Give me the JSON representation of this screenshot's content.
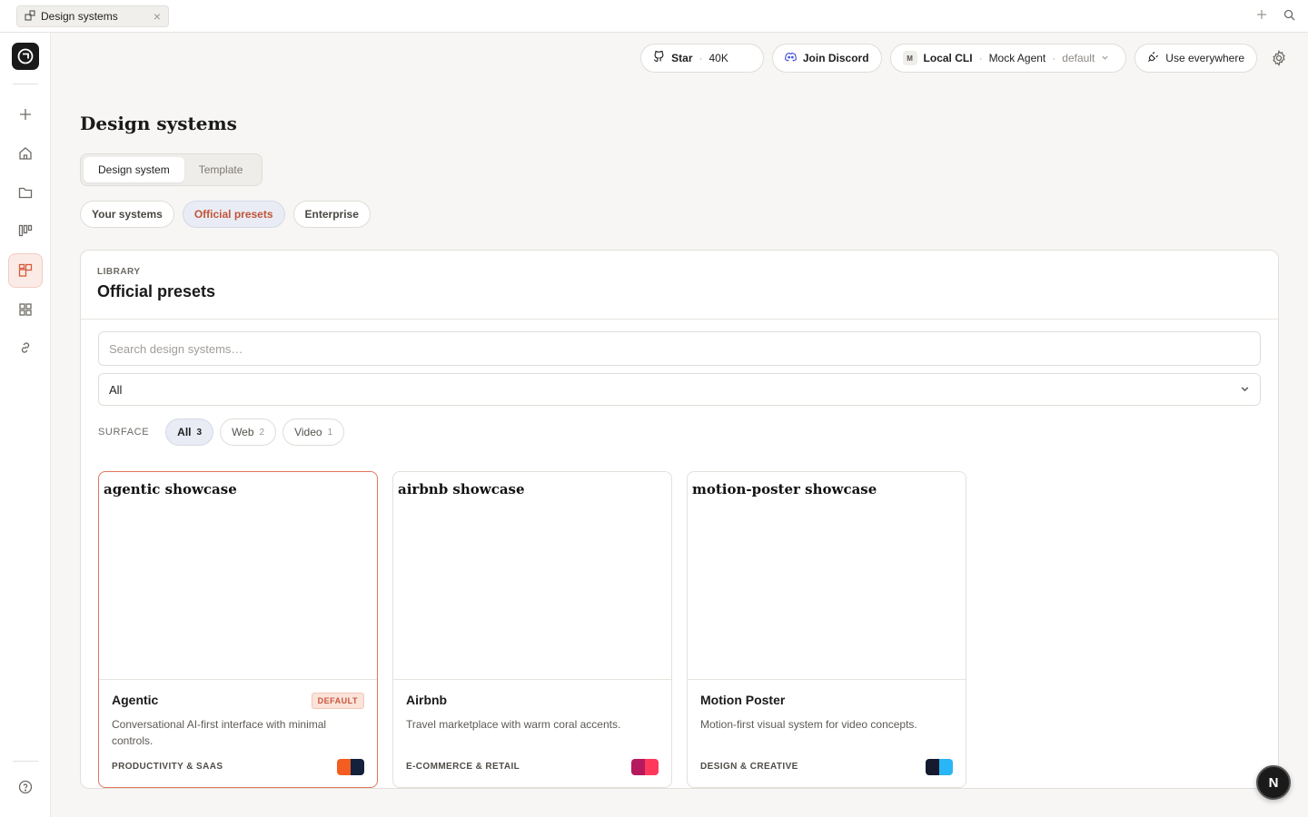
{
  "tab": {
    "title": "Design systems",
    "icon": "design-system-icon"
  },
  "toolbar": {
    "star_label": "Star",
    "star_count": "40K",
    "discord_label": "Join Discord",
    "agent_badge": "M",
    "agent_cli": "Local CLI",
    "agent_name": "Mock Agent",
    "agent_mode": "default",
    "use_everywhere": "Use everywhere"
  },
  "page": {
    "title": "Design systems"
  },
  "segment": {
    "items": [
      "Design system",
      "Template"
    ],
    "selected": "Design system"
  },
  "filters": {
    "items": [
      "Your systems",
      "Official presets",
      "Enterprise"
    ],
    "selected": "Official presets"
  },
  "library": {
    "eyebrow": "LIBRARY",
    "title": "Official presets",
    "search_placeholder": "Search design systems…",
    "category_value": "All",
    "surface_label": "SURFACE",
    "surfaces": [
      {
        "label": "All",
        "count": "3"
      },
      {
        "label": "Web",
        "count": "2"
      },
      {
        "label": "Video",
        "count": "1"
      }
    ]
  },
  "cards": [
    {
      "preview_title": "agentic showcase",
      "name": "Agentic",
      "badge": "DEFAULT",
      "description": "Conversational AI-first interface with minimal controls.",
      "category": "PRODUCTIVITY & SAAS",
      "colors": [
        "#f45d22",
        "#14213d"
      ]
    },
    {
      "preview_title": "airbnb showcase",
      "name": "Airbnb",
      "badge": "",
      "description": "Travel marketplace with warm coral accents.",
      "category": "E-COMMERCE & RETAIL",
      "colors": [
        "#b5195e",
        "#ff385c"
      ]
    },
    {
      "preview_title": "motion-poster showcase",
      "name": "Motion Poster",
      "badge": "",
      "description": "Motion-first visual system for video concepts.",
      "category": "DESIGN & CREATIVE",
      "colors": [
        "#151a2e",
        "#29b6f6"
      ]
    }
  ],
  "fab": {
    "label": "N"
  },
  "colors": {
    "accent": "#d65a3d",
    "selected_border": "#e2765e",
    "filter_active_bg": "#e9ecf4"
  }
}
